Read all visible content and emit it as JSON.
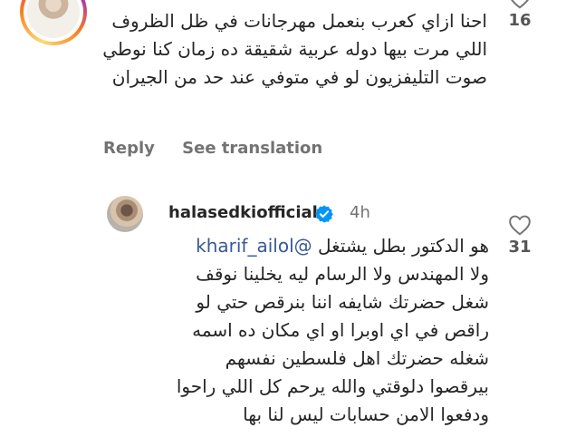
{
  "comments": [
    {
      "likes": "16",
      "text": "احنا ازاي كعرب بنعمل مهرجانات في ظل الظروف اللي مرت بيها دوله عربية شقيقة ده زمان كنا نوطي صوت التليفزيون لو في متوفي عند حد من الجيران",
      "actions": {
        "reply": "Reply",
        "translate": "See translation"
      }
    },
    {
      "username": "halasedkiofficial",
      "time": "4h",
      "likes": "31",
      "mention": "@kharif_ailol",
      "text_lead": "هو الدكتور بطل يشتغل",
      "text": "ولا المهندس ولا الرسام ليه يخلينا نوقف شغل حضرتك شايفه اننا بنرقص حتي لو راقص في اي اوبرا او اي مكان ده اسمه شغله حضرتك اهل فلسطين نفسهم بيرقصوا دلوقتي والله يرحم كل اللي راحوا ودفعوا الامن حسابات ليس لنا بها"
    }
  ],
  "icons": {
    "like": "heart-outline-icon",
    "verified": "verified-badge-icon"
  },
  "colors": {
    "verified": "#0095f6",
    "mention": "#385898",
    "muted": "#737373"
  }
}
